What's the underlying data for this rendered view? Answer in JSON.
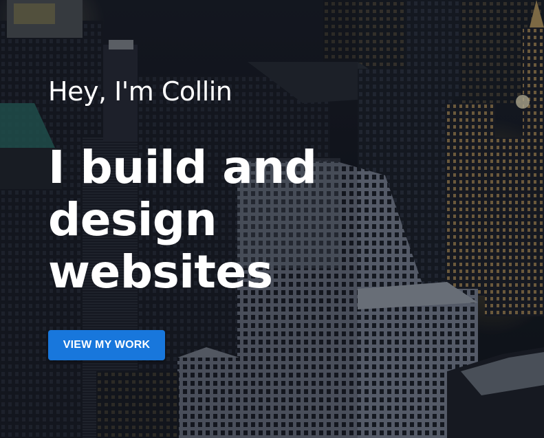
{
  "hero": {
    "greeting": "Hey, I'm Collin",
    "headline": "I build and design websites",
    "cta_label": "VIEW MY WORK"
  },
  "colors": {
    "cta_background": "#1877dc",
    "text": "#ffffff",
    "night_sky": "#10141b",
    "window_light": "#e8c06a"
  },
  "background": {
    "image": "city-skyline-at-night"
  }
}
